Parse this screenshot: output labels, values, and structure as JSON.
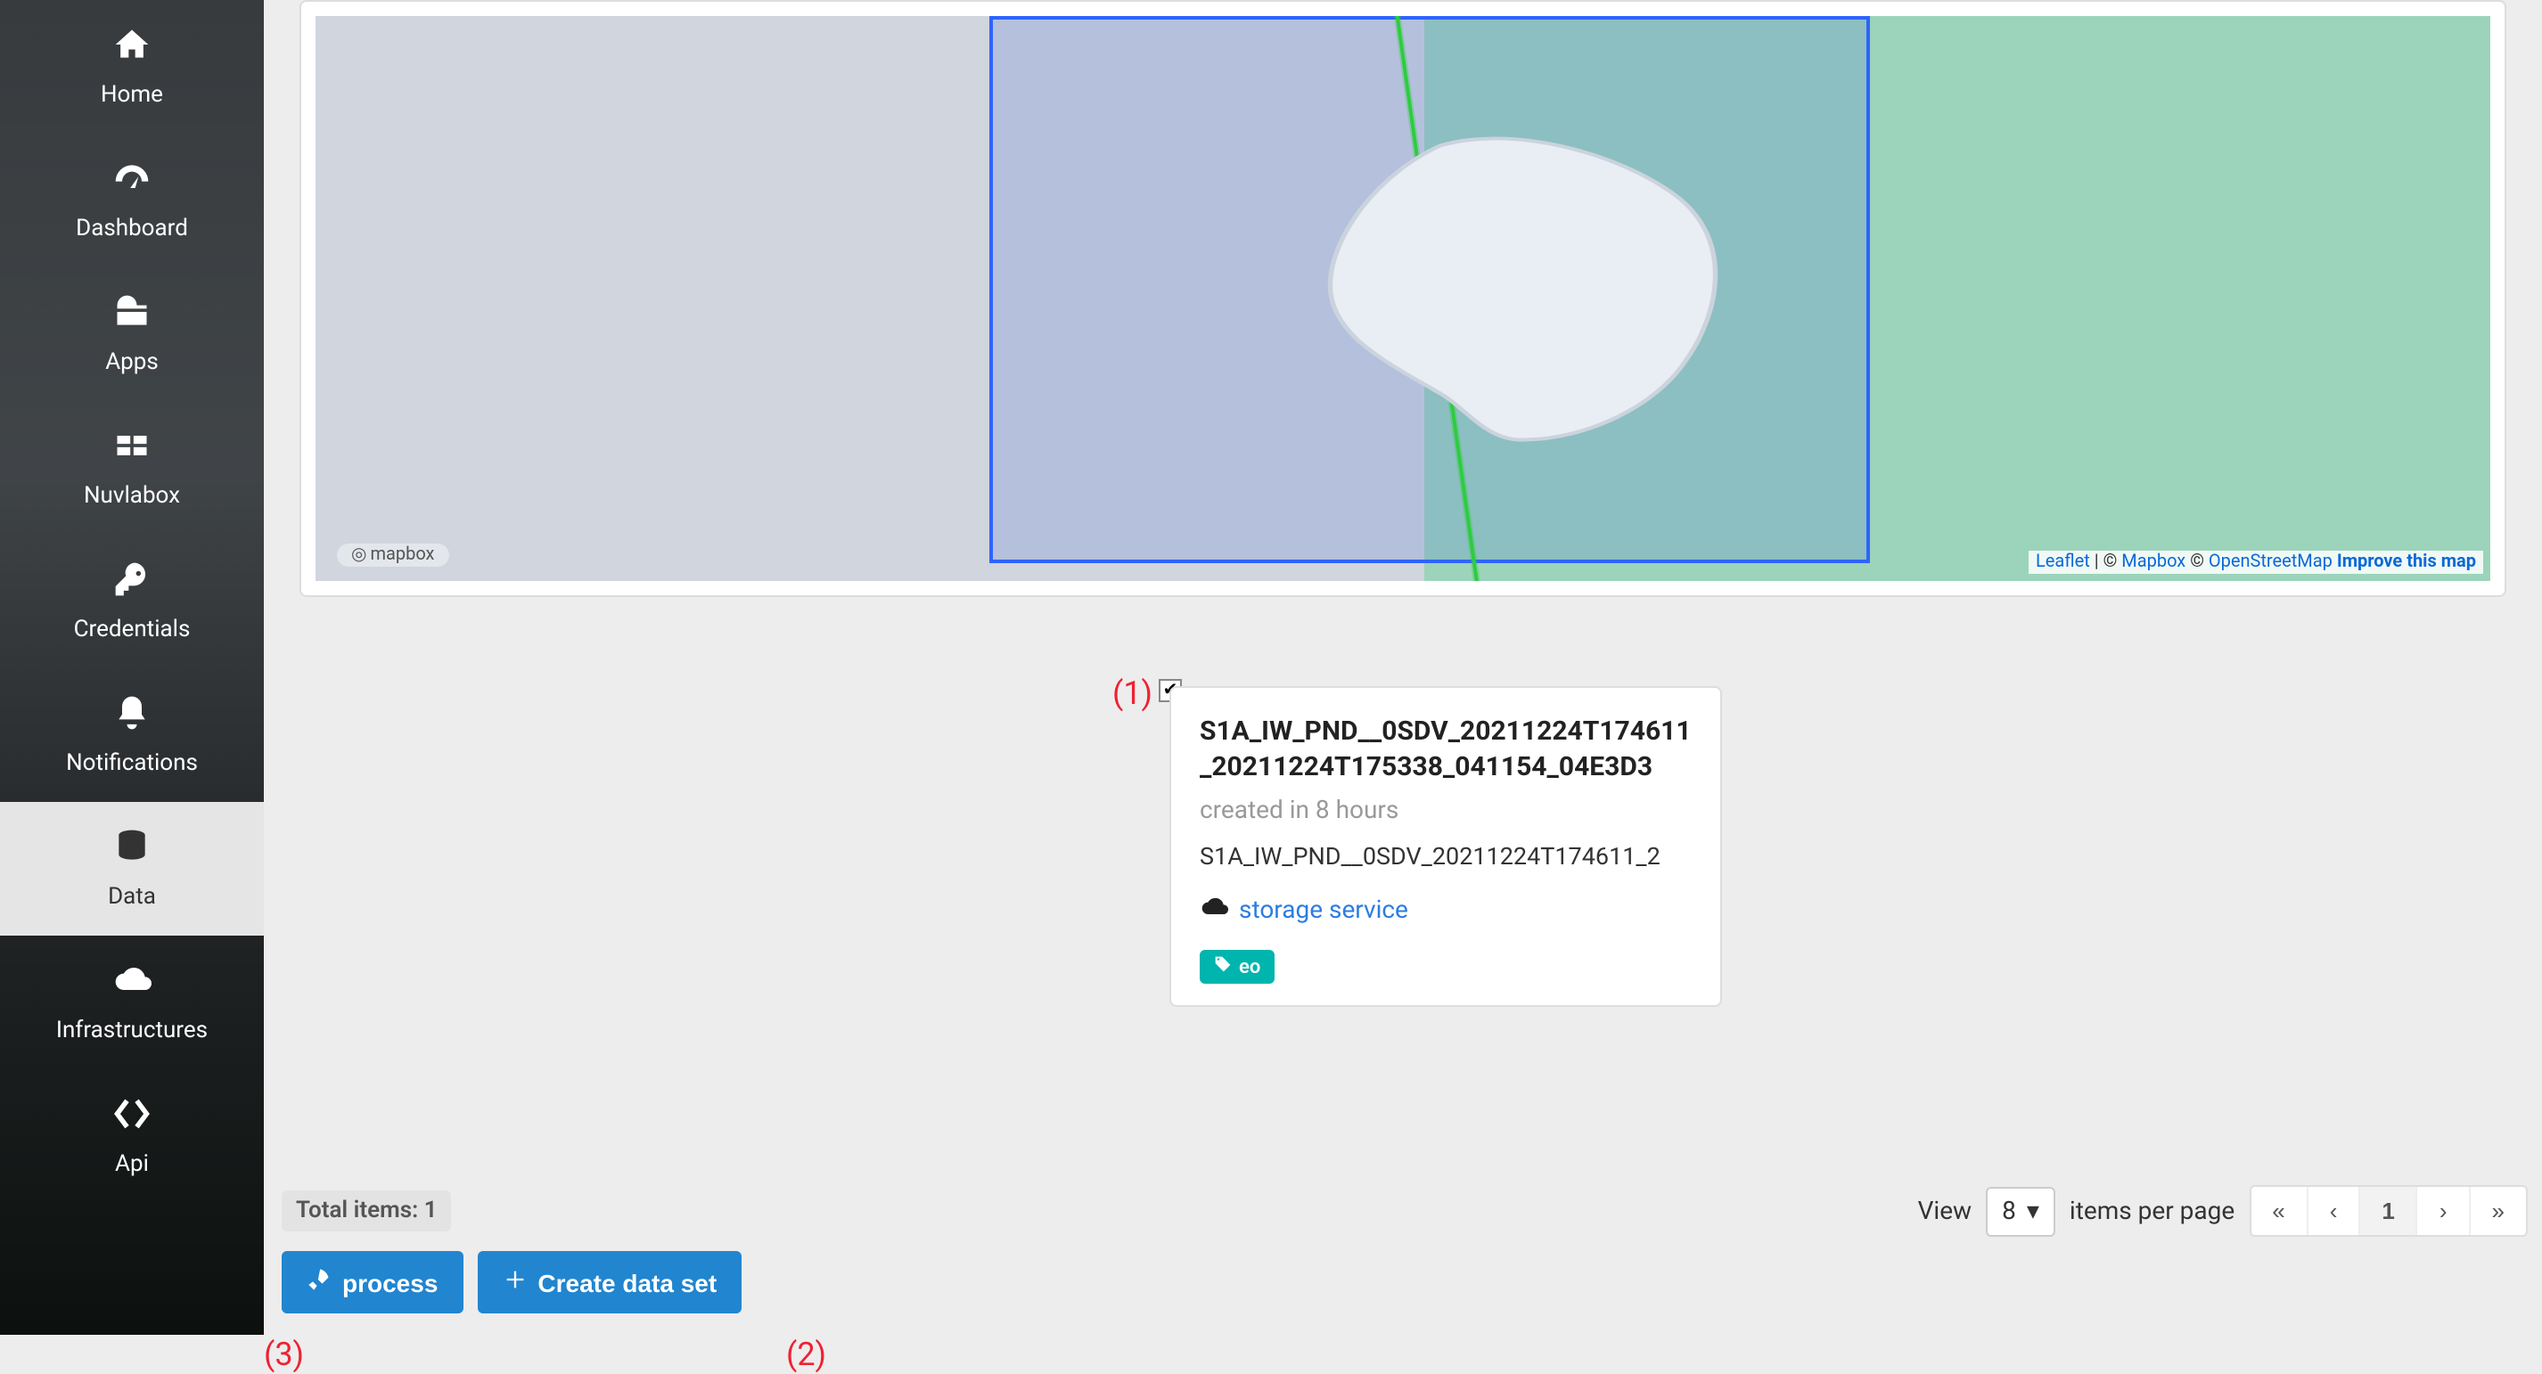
{
  "sidebar": {
    "items": [
      {
        "label": "Home",
        "icon": "home-icon"
      },
      {
        "label": "Dashboard",
        "icon": "dashboard-icon"
      },
      {
        "label": "Apps",
        "icon": "apps-icon"
      },
      {
        "label": "Nuvlabox",
        "icon": "nuvlabox-icon"
      },
      {
        "label": "Credentials",
        "icon": "credentials-icon"
      },
      {
        "label": "Notifications",
        "icon": "notifications-icon"
      },
      {
        "label": "Data",
        "icon": "data-icon",
        "active": true
      },
      {
        "label": "Infrastructures",
        "icon": "infrastructures-icon"
      },
      {
        "label": "Api",
        "icon": "api-icon"
      }
    ]
  },
  "map": {
    "mapbox_logo_text": "mapbox",
    "attribution": {
      "leaflet": "Leaflet",
      "sep1": " | © ",
      "mapbox": "Mapbox",
      "sep2": " © ",
      "osm": "OpenStreetMap",
      "improve": "Improve this map"
    }
  },
  "annotations": {
    "a1": "(1)",
    "a2": "(2)",
    "a3": "(3)"
  },
  "card": {
    "checked": true,
    "title": "S1A_IW_PND__0SDV_20211224T174611_20211224T175338_041154_04E3D3",
    "created": "created in 8 hours",
    "filename_truncated": "S1A_IW_PND__0SDV_20211224T174611_2",
    "storage_link": "storage service",
    "tag": "eo"
  },
  "footer": {
    "total_items": "Total items: 1",
    "view_label": "View",
    "items_per_page_label": "items per page",
    "page_size": "8",
    "current_page": "1",
    "process_label": "process",
    "create_dataset_label": "Create data set"
  }
}
